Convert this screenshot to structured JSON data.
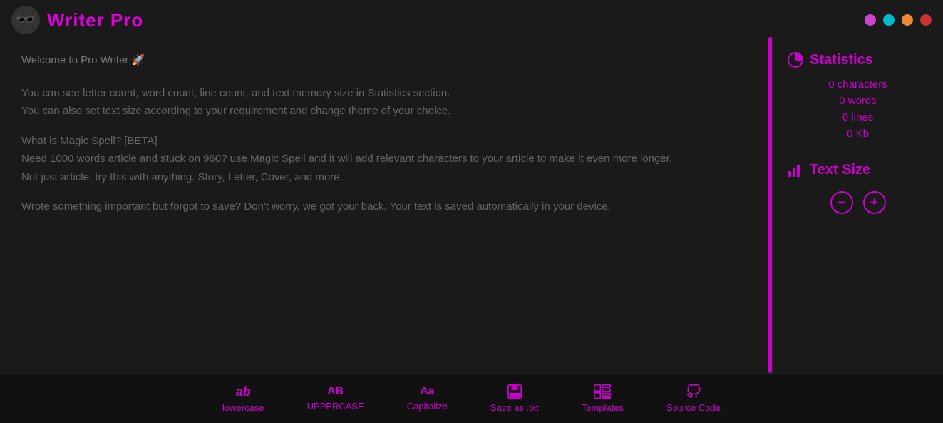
{
  "app": {
    "title": "Writer Pro",
    "avatar_emoji": "🕶️"
  },
  "window_controls": [
    {
      "color": "#dd55dd",
      "name": "control-1"
    },
    {
      "color": "#00ccdd",
      "name": "control-2"
    },
    {
      "color": "#ee8844",
      "name": "control-3"
    },
    {
      "color": "#dd4444",
      "name": "control-4"
    }
  ],
  "editor": {
    "content_paragraphs": [
      "Welcome to Pro Writer 🚀",
      "You can see letter count, word count, line count, and text memory size in Statistics section.\nYou can also set text size according to your requirement and change theme of your choice.",
      "What is Magic Spell? [BETA]\nNeed 1000 words article and stuck on 960? use Magic Spell and it will add relevant characters to your article to make it even more longer.\nNot just article, try this with anything. Story, Letter, Cover, and more.",
      "Wrote something important but forgot to save? Don't worry, we got your back. Your text is saved automatically in your device."
    ]
  },
  "statistics": {
    "section_title": "Statistics",
    "characters_label": "0 characters",
    "words_label": "0 words",
    "lines_label": "0 lines",
    "size_label": "0 Kb"
  },
  "text_size": {
    "section_title": "Text Size",
    "decrease_label": "−",
    "increase_label": "+"
  },
  "toolbar": {
    "items": [
      {
        "icon": "ab",
        "label": "lowercase",
        "name": "lowercase-tool"
      },
      {
        "icon": "AB",
        "label": "UPPERCASE",
        "name": "uppercase-tool"
      },
      {
        "icon": "Aa",
        "label": "Capitalize",
        "name": "capitalize-tool"
      },
      {
        "icon": "💾",
        "label": "Save as .txt",
        "name": "save-txt-tool"
      },
      {
        "icon": "⊞",
        "label": "Templates",
        "name": "templates-tool"
      },
      {
        "icon": "⌥",
        "label": "Source Code",
        "name": "source-code-tool"
      }
    ]
  }
}
